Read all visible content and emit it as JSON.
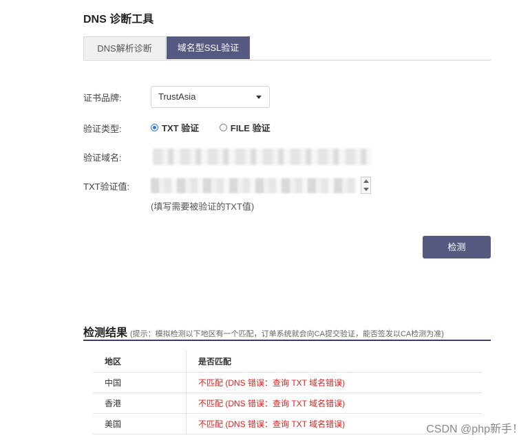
{
  "page": {
    "title": "DNS 诊断工具"
  },
  "tabs": [
    {
      "label": "DNS解析诊断"
    },
    {
      "label": "域名型SSL验证"
    }
  ],
  "form": {
    "brand_label": "证书品牌:",
    "brand_value": "TrustAsia",
    "type_label": "验证类型:",
    "type_options": [
      {
        "label": "TXT 验证",
        "checked": true
      },
      {
        "label": "FILE 验证",
        "checked": false
      }
    ],
    "domain_label": "验证域名:",
    "txt_label": "TXT验证值:",
    "txt_hint": "(填写需要被验证的TXT值)",
    "check_button": "检测"
  },
  "results": {
    "title": "检测结果",
    "note": "(提示：模拟检测以下地区有一个匹配，订单系统就会向CA提交验证，能否签发以CA检测为准)",
    "columns": [
      "地区",
      "是否匹配"
    ],
    "rows": [
      {
        "region": "中国",
        "match": "不匹配 (DNS 错误：查询 TXT 域名错误)"
      },
      {
        "region": "香港",
        "match": "不匹配 (DNS 错误：查询 TXT 域名错误)"
      },
      {
        "region": "美国",
        "match": "不匹配 (DNS 错误：查询 TXT 域名错误)"
      }
    ]
  },
  "watermark": "CSDN @php新手！",
  "colors": {
    "accent": "#565a80",
    "error": "#e02020",
    "radio": "#2f7bd8"
  }
}
